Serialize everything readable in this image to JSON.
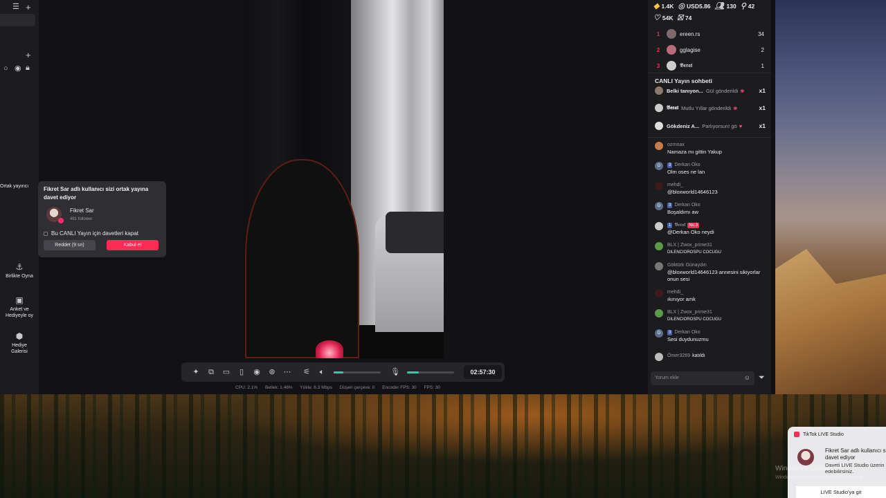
{
  "left_panel": {
    "ortak_label": "Ortak yayıncı",
    "side_buttons": [
      {
        "label": "Birlikte Oyna",
        "icon": "play-together-icon"
      },
      {
        "label": "Anket ve Hediyeyle oy",
        "icon": "poll-icon"
      },
      {
        "label": "Hediye Galerisi",
        "icon": "gift-gallery-icon"
      }
    ]
  },
  "invite_popup": {
    "title": "Fikret Sar adlı kullanıcı sizi ortak yayına davet ediyor",
    "user_name": "Fikret Sar",
    "followers": "481 follower",
    "checkbox_label": "Bu CANLI Yayın için davetleri kapat",
    "reject_label": "Reddet (9 sn)",
    "accept_label": "Kabul et"
  },
  "toolbar": {
    "timer": "02:57:30",
    "volume_level": 0.2,
    "mic_level": 0.25
  },
  "stats": {
    "cpu": "CPU: 2.1%",
    "memory": "Bellek: 1.46%",
    "upload": "Yükle: 6.3 Mbps",
    "dropped": "Düşen çerçeve: 0",
    "encoder_fps": "Encoder FPS: 30",
    "fps": "FPS: 30"
  },
  "right_panel": {
    "metrics": [
      {
        "icon": "coin-icon",
        "value": "1.4K"
      },
      {
        "icon": "dollar-icon",
        "value": "USD5.86"
      },
      {
        "icon": "viewers-icon",
        "value": "130"
      },
      {
        "icon": "person-icon",
        "value": "42"
      },
      {
        "icon": "heart-icon",
        "value": "54K"
      },
      {
        "icon": "gift-icon",
        "value": "74"
      }
    ],
    "ranking": [
      {
        "rank": "1",
        "name": "ereen.rs",
        "count": "34"
      },
      {
        "rank": "2",
        "name": "gglagise",
        "count": "2"
      },
      {
        "rank": "3",
        "name": "𝕭𝖊𝖗𝖆𝖙",
        "count": "1"
      }
    ],
    "chat_title": "CANLI Yayın sohbeti",
    "gifts": [
      {
        "name": "Belki tanıyon...",
        "text": "Gül gönderildi",
        "mult": "x1"
      },
      {
        "name": "𝕭𝖊𝖗𝖆𝖙",
        "text": "Mutlu Yıllar gönderildi",
        "mult": "x1"
      },
      {
        "name": "Gökdeniz A...",
        "text": "Parlıyorsun! gö",
        "mult": "x1"
      }
    ],
    "messages": [
      {
        "user": "ozrnnax",
        "text": "Namaza mı gittin Yakup",
        "badges": []
      },
      {
        "user": "Derkan Oko",
        "text": "Olm oses ne lan",
        "badges": [
          "3"
        ]
      },
      {
        "user": "mehdi_",
        "text": "@bloxworld14646123",
        "badges": []
      },
      {
        "user": "Derkan Oko",
        "text": "Boşaldımı aw",
        "badges": [
          "3"
        ]
      },
      {
        "user": "𝕭𝖊𝖗𝖆𝖙",
        "text": "@Derkan Oko neydi",
        "badges": [
          "1",
          "No.3"
        ]
      },
      {
        "user": "BLX | Zwox_prime31",
        "text": "DILENCIOROSPU COCUGU",
        "badges": []
      },
      {
        "user": "Göktürk Günaydın",
        "text": "@bloxworld14646123 annesini sikiyorlar onun sesi",
        "badges": []
      },
      {
        "user": "mehdi_",
        "text": "ıkınıyor amk",
        "badges": []
      },
      {
        "user": "BLX | Zwox_prime31",
        "text": "DILENCIOROSPU COCUGU",
        "badges": []
      },
      {
        "user": "Derkan Oko",
        "text": "Sesi duydunuzmu",
        "badges": [
          "3"
        ]
      }
    ],
    "joined": {
      "user": "Ömer3269",
      "text": "katıldı"
    },
    "comment_placeholder": "Yorum ekle"
  },
  "toast": {
    "app": "TikTok LIVE Studio",
    "line1": "Fikret Sar adlı kullanıcı si",
    "line2": "davet ediyor",
    "sub1": "Daveti LIVE Studio üzerin",
    "sub2": "edebilirsiniz.",
    "button": "LIVE Studio'ya git"
  },
  "watermark": {
    "line1": "Windows'u Etkinleştir",
    "line2": "Windows'u etkinleştirmek için Ayarlar'a git"
  },
  "colors": {
    "accent": "#fe2c55",
    "slider": "#2ad1a8"
  }
}
